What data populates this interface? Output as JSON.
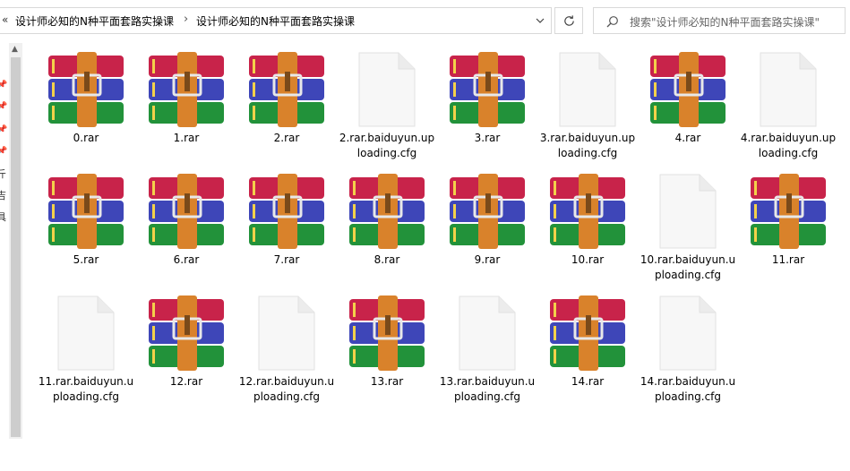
{
  "address": {
    "overflow": "«",
    "crumbs": [
      "设计师必知的N种平面套路实操课",
      "设计师必知的N种平面套路实操课"
    ]
  },
  "search": {
    "placeholder": "搜索\"设计师必知的N种平面套路实操课\""
  },
  "nav": {
    "fragments": [
      "斤",
      "吉",
      "具 I"
    ]
  },
  "files": [
    {
      "name": "0.rar",
      "type": "rar"
    },
    {
      "name": "1.rar",
      "type": "rar"
    },
    {
      "name": "2.rar",
      "type": "rar"
    },
    {
      "name": "2.rar.baiduyun.uploading.cfg",
      "type": "file"
    },
    {
      "name": "3.rar",
      "type": "rar"
    },
    {
      "name": "3.rar.baiduyun.uploading.cfg",
      "type": "file"
    },
    {
      "name": "4.rar",
      "type": "rar"
    },
    {
      "name": "4.rar.baiduyun.uploading.cfg",
      "type": "file"
    },
    {
      "name": "5.rar",
      "type": "rar"
    },
    {
      "name": "6.rar",
      "type": "rar"
    },
    {
      "name": "7.rar",
      "type": "rar"
    },
    {
      "name": "8.rar",
      "type": "rar"
    },
    {
      "name": "9.rar",
      "type": "rar"
    },
    {
      "name": "10.rar",
      "type": "rar"
    },
    {
      "name": "10.rar.baiduyun.uploading.cfg",
      "type": "file"
    },
    {
      "name": "11.rar",
      "type": "rar"
    },
    {
      "name": "11.rar.baiduyun.uploading.cfg",
      "type": "file"
    },
    {
      "name": "12.rar",
      "type": "rar"
    },
    {
      "name": "12.rar.baiduyun.uploading.cfg",
      "type": "file"
    },
    {
      "name": "13.rar",
      "type": "rar"
    },
    {
      "name": "13.rar.baiduyun.uploading.cfg",
      "type": "file"
    },
    {
      "name": "14.rar",
      "type": "rar"
    },
    {
      "name": "14.rar.baiduyun.uploading.cfg",
      "type": "file"
    }
  ],
  "colors": {
    "rar_red": "#c8234a",
    "rar_blue": "#3e46b8",
    "rar_green": "#22923a",
    "rar_strap": "#d9822b",
    "page_file": "#f7f7f7"
  }
}
